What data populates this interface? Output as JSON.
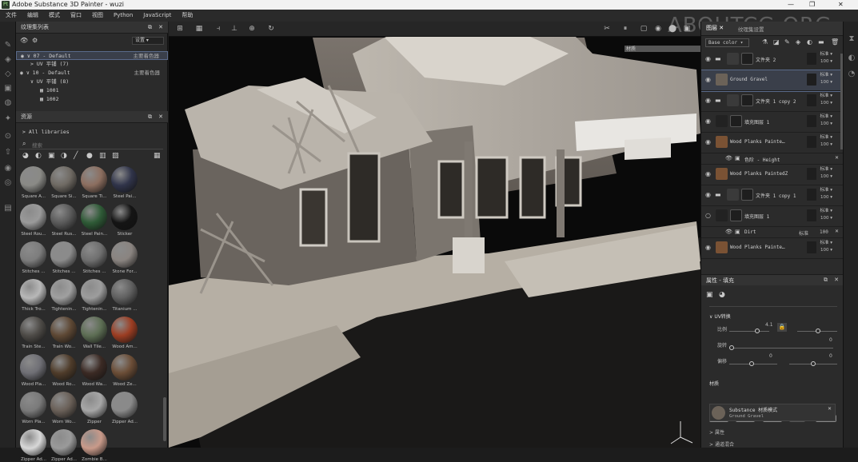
{
  "window": {
    "title": "Adobe Substance 3D Painter - wuzi",
    "logo": "Pt"
  },
  "menu": [
    "文件",
    "编辑",
    "模式",
    "窗口",
    "视图",
    "Python",
    "JavaScript",
    "帮助"
  ],
  "texture_set_panel": {
    "title": "纹理集列表",
    "settings_label": "设置",
    "rows": [
      {
        "label": "07 - Default",
        "right": "主要着色器"
      },
      {
        "label": "UV 平铺 (7)",
        "right": ""
      },
      {
        "label": "10 - Default",
        "right": "主要着色器"
      },
      {
        "label": "UV 平铺 (8)",
        "right": ""
      },
      {
        "label": "1001",
        "right": ""
      },
      {
        "label": "1002",
        "right": ""
      }
    ]
  },
  "assets_panel": {
    "title": "资源",
    "library": "All libraries",
    "search_placeholder": "搜索",
    "materials": [
      {
        "label": "Square A...",
        "color": "#8a8a86"
      },
      {
        "label": "Square Si...",
        "color": "#6f6a63"
      },
      {
        "label": "Square Ti...",
        "color": "#8c6e5f"
      },
      {
        "label": "Steel Pai...",
        "color": "#30344a"
      },
      {
        "label": "Steel Rou...",
        "color": "#9a9a9a"
      },
      {
        "label": "Steel Rus...",
        "color": "#5a5a5a"
      },
      {
        "label": "Steel Pain...",
        "color": "#2e5a36"
      },
      {
        "label": "Sticker",
        "color": "#141414"
      },
      {
        "label": "Stitches ...",
        "color": "#7d7d7d"
      },
      {
        "label": "Stitches ...",
        "color": "#8b8b8b"
      },
      {
        "label": "Stitches ...",
        "color": "#6f6f6f"
      },
      {
        "label": "Stone For...",
        "color": "#8a8480"
      },
      {
        "label": "Thick Tro...",
        "color": "#b8b8b8"
      },
      {
        "label": "Tightenin...",
        "color": "#a0a0a0"
      },
      {
        "label": "Tightenin...",
        "color": "#9d9d9d"
      },
      {
        "label": "Titanium ...",
        "color": "#606060"
      },
      {
        "label": "Train Ste...",
        "color": "#4e4b47"
      },
      {
        "label": "Train Wo...",
        "color": "#5e4834"
      },
      {
        "label": "Wall Tile...",
        "color": "#5d6e54"
      },
      {
        "label": "Wood Am...",
        "color": "#9c3d22"
      },
      {
        "label": "Wood Pla...",
        "color": "#6f6f75"
      },
      {
        "label": "Wood Ro...",
        "color": "#4f3c2a"
      },
      {
        "label": "Wood Wa...",
        "color": "#3b2a24"
      },
      {
        "label": "Wood Ze...",
        "color": "#6b4d36"
      },
      {
        "label": "Worn Pla...",
        "color": "#7a7a7a"
      },
      {
        "label": "Worn Wo...",
        "color": "#6a6058"
      },
      {
        "label": "Zipper",
        "color": "#a7a7a7"
      },
      {
        "label": "Zipper Ad...",
        "color": "#8a8a8a"
      },
      {
        "label": "Zipper Ad...",
        "color": "#d8d8d8"
      },
      {
        "label": "Zipper Ad...",
        "color": "#9a9a9a"
      },
      {
        "label": "Zombie B...",
        "color": "#c99a8a"
      }
    ]
  },
  "viewport": {
    "watermark": "ABOUTCG.ORG",
    "material_label": "材质"
  },
  "layers_panel": {
    "tab_layers": "图层",
    "tab_texture_settings": "纹理集设置",
    "blend_mode": "Base color",
    "layers": [
      {
        "name": "文件夹 2",
        "blend": "标准",
        "opacity": "100",
        "type": "folder",
        "color": "#3a3a3a"
      },
      {
        "name": "Ground Gravel",
        "blend": "标准",
        "opacity": "100",
        "type": "fill",
        "color": "#6b6258"
      },
      {
        "name": "文件夹 1 copy 2",
        "blend": "标准",
        "opacity": "100",
        "type": "folder",
        "color": "#3a3a3a"
      },
      {
        "name": "填充图层 1",
        "blend": "标准",
        "opacity": "100",
        "type": "fill",
        "color": "#222222"
      },
      {
        "name": "Wood Planks Painte…",
        "blend": "标准",
        "opacity": "100",
        "type": "fill",
        "color": "#7a5234"
      },
      {
        "name": "色阶 - Height",
        "blend": "",
        "opacity": "",
        "type": "effect",
        "color": ""
      },
      {
        "name": "Wood Planks PaintedZ",
        "blend": "标准",
        "opacity": "100",
        "type": "fill",
        "color": "#7a5234"
      },
      {
        "name": "文件夹 1 copy 1",
        "blend": "标准",
        "opacity": "100",
        "type": "folder",
        "color": "#3a3a3a"
      },
      {
        "name": "填充图层 1",
        "blend": "标准",
        "opacity": "100",
        "type": "fill",
        "color": "#222222"
      },
      {
        "name": "Dirt",
        "blend": "标准",
        "opacity": "100",
        "type": "effect",
        "color": ""
      },
      {
        "name": "Wood Planks Painte…",
        "blend": "标准",
        "opacity": "100",
        "type": "fill",
        "color": "#7a5234"
      }
    ]
  },
  "properties_panel": {
    "title": "属性 - 填充",
    "uv_section": "UV转换",
    "scale_label": "比例",
    "scale_value": "4.1",
    "rotation_label": "旋转",
    "rotation_value": "0",
    "offset_label": "偏移",
    "offset_value_1": "0",
    "offset_value_2": "0",
    "material_section": "材质",
    "channels": [
      "color",
      "metal",
      "rough",
      "nrm",
      "height"
    ],
    "material_mode": "Substance 材质模式",
    "material_name": "Ground Gravel",
    "attributes_label": "属性",
    "blend_section": "通道混合"
  }
}
